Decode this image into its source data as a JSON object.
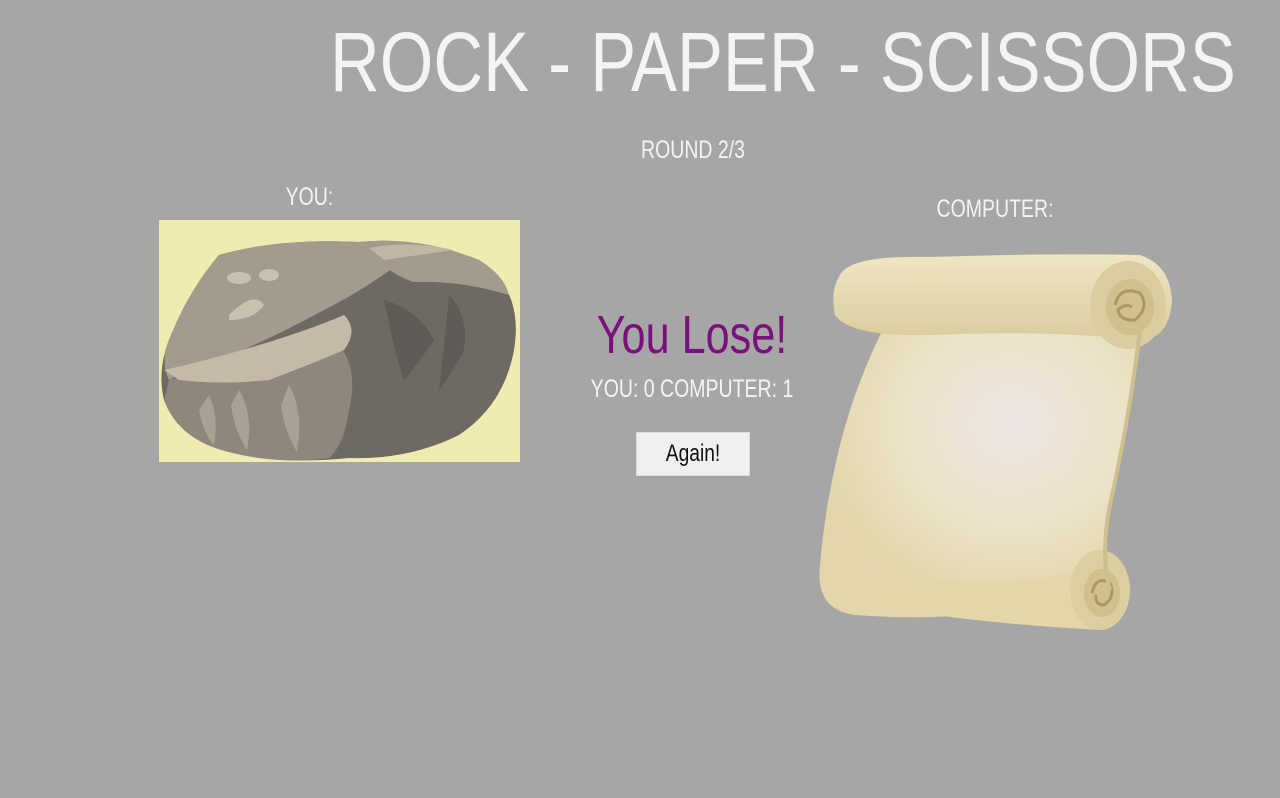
{
  "game": {
    "title": "ROCK - PAPER - SCISSORS",
    "round": "ROUND 2/3"
  },
  "player": {
    "label": "YOU:",
    "choice_icon": "rock-icon",
    "panel_color": "#f0ebb1"
  },
  "computer": {
    "label": "COMPUTER:",
    "choice_icon": "paper-scroll-icon"
  },
  "result": {
    "text": "You Lose!",
    "color": "#7b0f7b",
    "score_text": "YOU: 0 COMPUTER: 1"
  },
  "controls": {
    "again_label": "Again!"
  },
  "colors": {
    "background": "#a6a6a6",
    "text": "#f4f4f4"
  }
}
